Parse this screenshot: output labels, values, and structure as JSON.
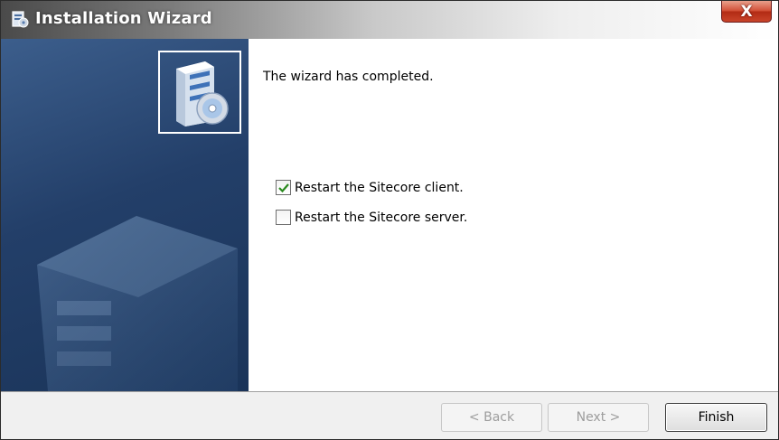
{
  "window": {
    "title": "Installation Wizard",
    "close_label": "X"
  },
  "icons": {
    "title": "installer-icon",
    "logo": "install-package-icon",
    "close": "close-icon",
    "check": "checkmark-icon"
  },
  "content": {
    "message": "The wizard has completed.",
    "options": [
      {
        "label": "Restart the Sitecore client.",
        "checked": true
      },
      {
        "label": "Restart the Sitecore server.",
        "checked": false
      }
    ]
  },
  "footer": {
    "back_label": "< Back",
    "next_label": "Next >",
    "finish_label": "Finish",
    "back_enabled": false,
    "next_enabled": false
  },
  "colors": {
    "side_panel": "#233f69",
    "checkmark": "#2a8a1e",
    "close_button": "#c9442a"
  }
}
